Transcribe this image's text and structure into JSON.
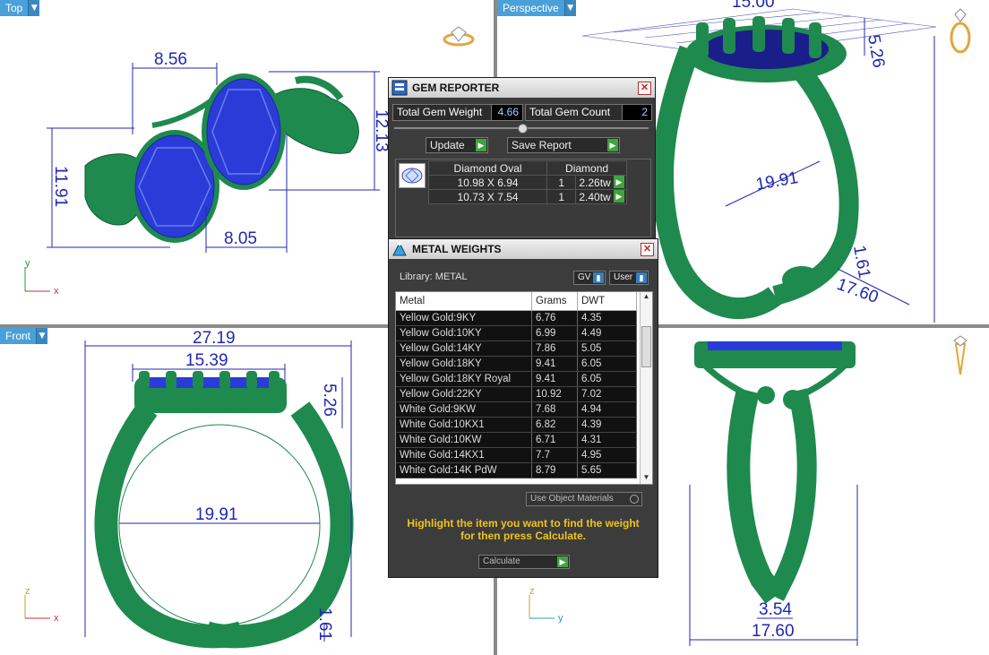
{
  "viewports": {
    "top": {
      "label": "Top",
      "dims": [
        "8.56",
        "12.13",
        "11.91",
        "8.05"
      ],
      "axes": [
        "y",
        "x"
      ]
    },
    "perspective": {
      "label": "Perspective",
      "dims": [
        "15.00",
        "5.26",
        "19.91",
        "1.61",
        "17.60"
      ]
    },
    "front": {
      "label": "Front",
      "dims": [
        "27.19",
        "15.39",
        "5.26",
        "19.91",
        "1.61"
      ],
      "axes": [
        "z",
        "x"
      ]
    },
    "right": {
      "dims": [
        "3.54",
        "17.60"
      ],
      "axes": [
        "z",
        "y"
      ]
    }
  },
  "gem_reporter": {
    "title": "GEM REPORTER",
    "total_weight_label": "Total Gem Weight",
    "total_weight": "4.66",
    "total_count_label": "Total Gem Count",
    "total_count": "2",
    "update_label": "Update",
    "save_label": "Save Report",
    "table": {
      "col1": "Diamond Oval",
      "col2": "Diamond",
      "rows": [
        {
          "size": "10.98 X 6.94",
          "qty": "1",
          "weight": "2.26tw"
        },
        {
          "size": "10.73 X 7.54",
          "qty": "1",
          "weight": "2.40tw"
        }
      ]
    }
  },
  "metal_weights": {
    "title": "METAL WEIGHTS",
    "library_label": "Library: METAL",
    "gv_label": "GV",
    "user_label": "User",
    "headers": [
      "Metal",
      "Grams",
      "DWT"
    ],
    "rows": [
      [
        "Yellow Gold:9KY",
        "6.76",
        "4.35"
      ],
      [
        "Yellow Gold:10KY",
        "6.99",
        "4.49"
      ],
      [
        "Yellow Gold:14KY",
        "7.86",
        "5.05"
      ],
      [
        "Yellow Gold:18KY",
        "9.41",
        "6.05"
      ],
      [
        "Yellow Gold:18KY Royal",
        "9.41",
        "6.05"
      ],
      [
        "Yellow Gold:22KY",
        "10.92",
        "7.02"
      ],
      [
        "White Gold:9KW",
        "7.68",
        "4.94"
      ],
      [
        "White Gold:10KX1",
        "6.82",
        "4.39"
      ],
      [
        "White Gold:10KW",
        "6.71",
        "4.31"
      ],
      [
        "White Gold:14KX1",
        "7.7",
        "4.95"
      ],
      [
        "White Gold:14K PdW",
        "8.79",
        "5.65"
      ]
    ],
    "use_object_label": "Use Object Materials",
    "hint": "Highlight the item you want to find the weight for then press Calculate.",
    "calculate_label": "Calculate"
  },
  "colors": {
    "ring": "#1f8a4e",
    "gem": "#2a3bd8",
    "dimension": "#1f28b0",
    "hint": "#f0c419"
  }
}
